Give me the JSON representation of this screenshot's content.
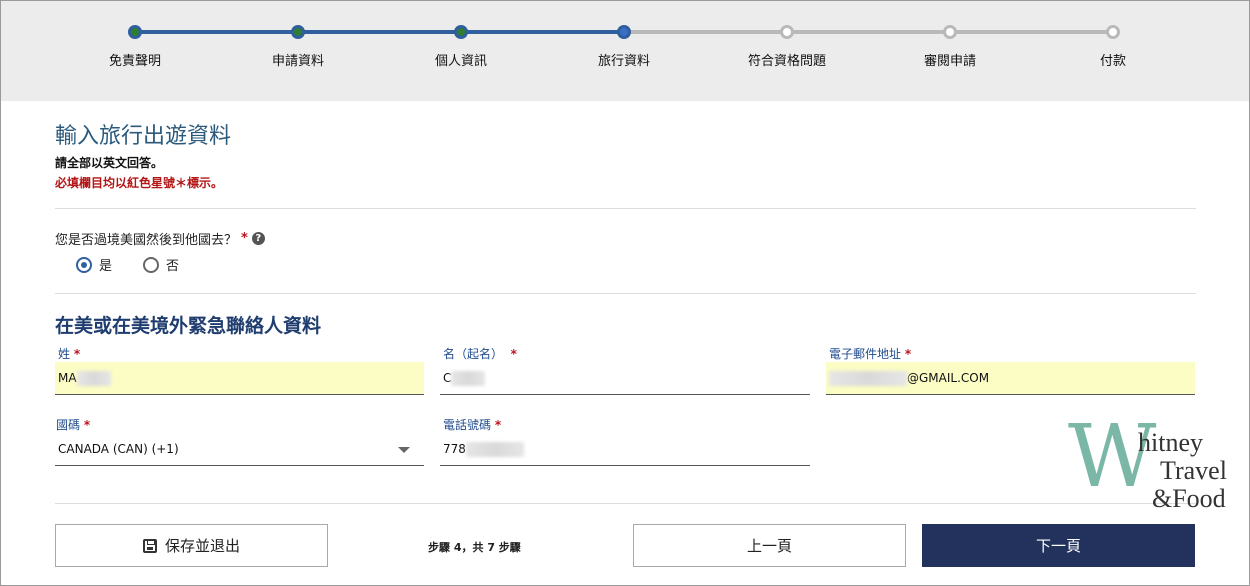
{
  "progress": {
    "steps": [
      {
        "label": "免責聲明",
        "state": "done"
      },
      {
        "label": "申請資料",
        "state": "done"
      },
      {
        "label": "個人資訊",
        "state": "done"
      },
      {
        "label": "旅行資料",
        "state": "current"
      },
      {
        "label": "符合資格問題",
        "state": "todo"
      },
      {
        "label": "審閱申請",
        "state": "todo"
      },
      {
        "label": "付款",
        "state": "todo"
      }
    ],
    "colors": {
      "done_track": "#2f5f9e",
      "todo_track": "#b9b9b9",
      "done_dot": "#2e7d32"
    }
  },
  "page": {
    "title": "輸入旅行出遊資料",
    "note_english": "請全部以英文回答。",
    "note_required": "必填欄目均以紅色星號＊標示。"
  },
  "transit": {
    "question": "您是否過境美國然後到他國去？",
    "required_mark": "*",
    "help_icon": "question-circle-icon",
    "options": [
      {
        "label": "是",
        "checked": true
      },
      {
        "label": "否",
        "checked": false
      }
    ]
  },
  "emergency": {
    "section_title": "在美或在美境外緊急聯絡人資料",
    "last_name": {
      "label": "姓",
      "required": "*",
      "value": "MA"
    },
    "first_name": {
      "label": "名（起名）",
      "required": "*",
      "value": "C"
    },
    "email": {
      "label": "電子郵件地址",
      "required": "*",
      "value": "@GMAIL.COM"
    },
    "country_code": {
      "label": "國碼",
      "required": "*",
      "value": "CANADA (CAN) (+1)"
    },
    "phone": {
      "label": "電話號碼",
      "required": "*",
      "value": "778"
    }
  },
  "footer": {
    "save_exit": "保存並退出",
    "step_count": "步驟 4，共 7 步驟",
    "previous": "上一頁",
    "next": "下一頁"
  },
  "watermark": {
    "letter": "W",
    "line1": "hitney",
    "line2": "Travel",
    "line3": "&Food"
  }
}
